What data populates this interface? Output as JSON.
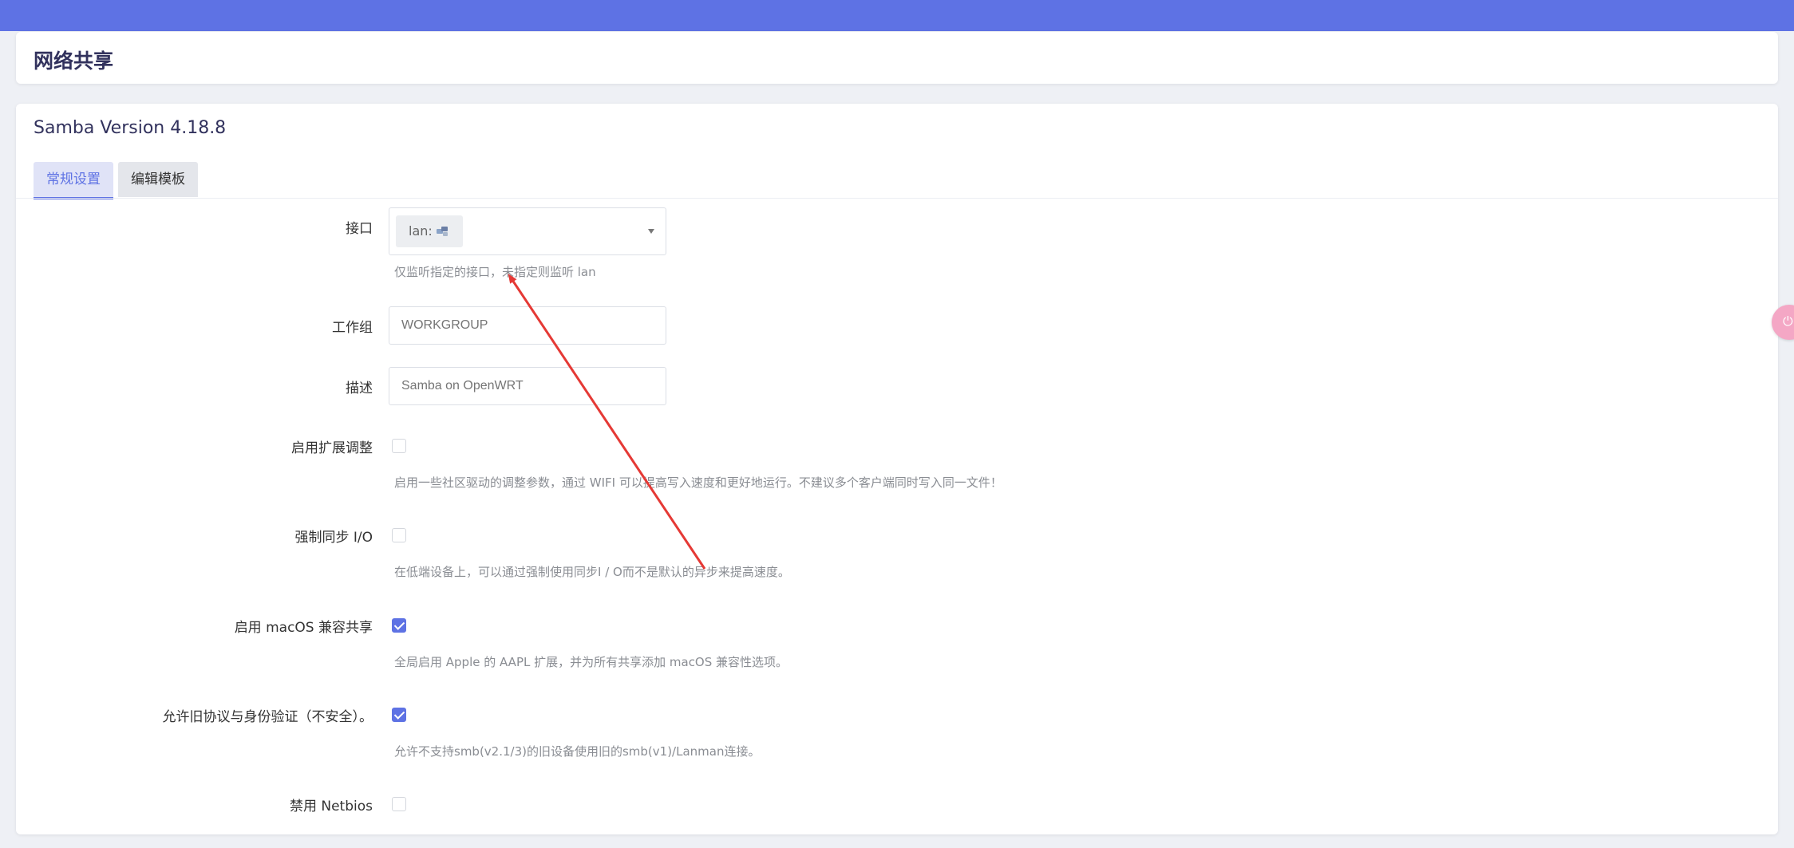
{
  "page_title": "网络共享",
  "section": {
    "version_title": "Samba Version 4.18.8"
  },
  "tabs": [
    {
      "label": "常规设置",
      "active": true
    },
    {
      "label": "编辑模板",
      "active": false
    }
  ],
  "fields": {
    "interface": {
      "label": "接口",
      "selected_chip": "lan:",
      "chip_icon": "network-devices-icon",
      "hint": "仅监听指定的接口，未指定则监听 lan"
    },
    "workgroup": {
      "label": "工作组",
      "placeholder": "WORKGROUP"
    },
    "description": {
      "label": "描述",
      "placeholder": "Samba on OpenWRT"
    },
    "extended_tuning": {
      "label": "启用扩展调整",
      "checked": false,
      "hint": "启用一些社区驱动的调整参数，通过 WIFI 可以提高写入速度和更好地运行。不建议多个客户端同时写入同一文件！"
    },
    "force_sync_io": {
      "label": "强制同步 I/O",
      "checked": false,
      "hint": "在低端设备上，可以通过强制使用同步I / O而不是默认的异步来提高速度。"
    },
    "macos_compat": {
      "label": "启用 macOS 兼容共享",
      "checked": true,
      "hint": "全局启用 Apple 的 AAPL 扩展，并为所有共享添加 macOS 兼容性选项。"
    },
    "legacy_protocol": {
      "label": "允许旧协议与身份验证（不安全）。",
      "checked": true,
      "hint": "允许不支持smb(v2.1/3)的旧设备使用旧的smb(v1)/Lanman连接。"
    },
    "disable_netbios": {
      "label": "禁用 Netbios",
      "checked": false
    }
  },
  "colors": {
    "accent": "#5e72e4",
    "annotation_arrow": "#e53935"
  }
}
